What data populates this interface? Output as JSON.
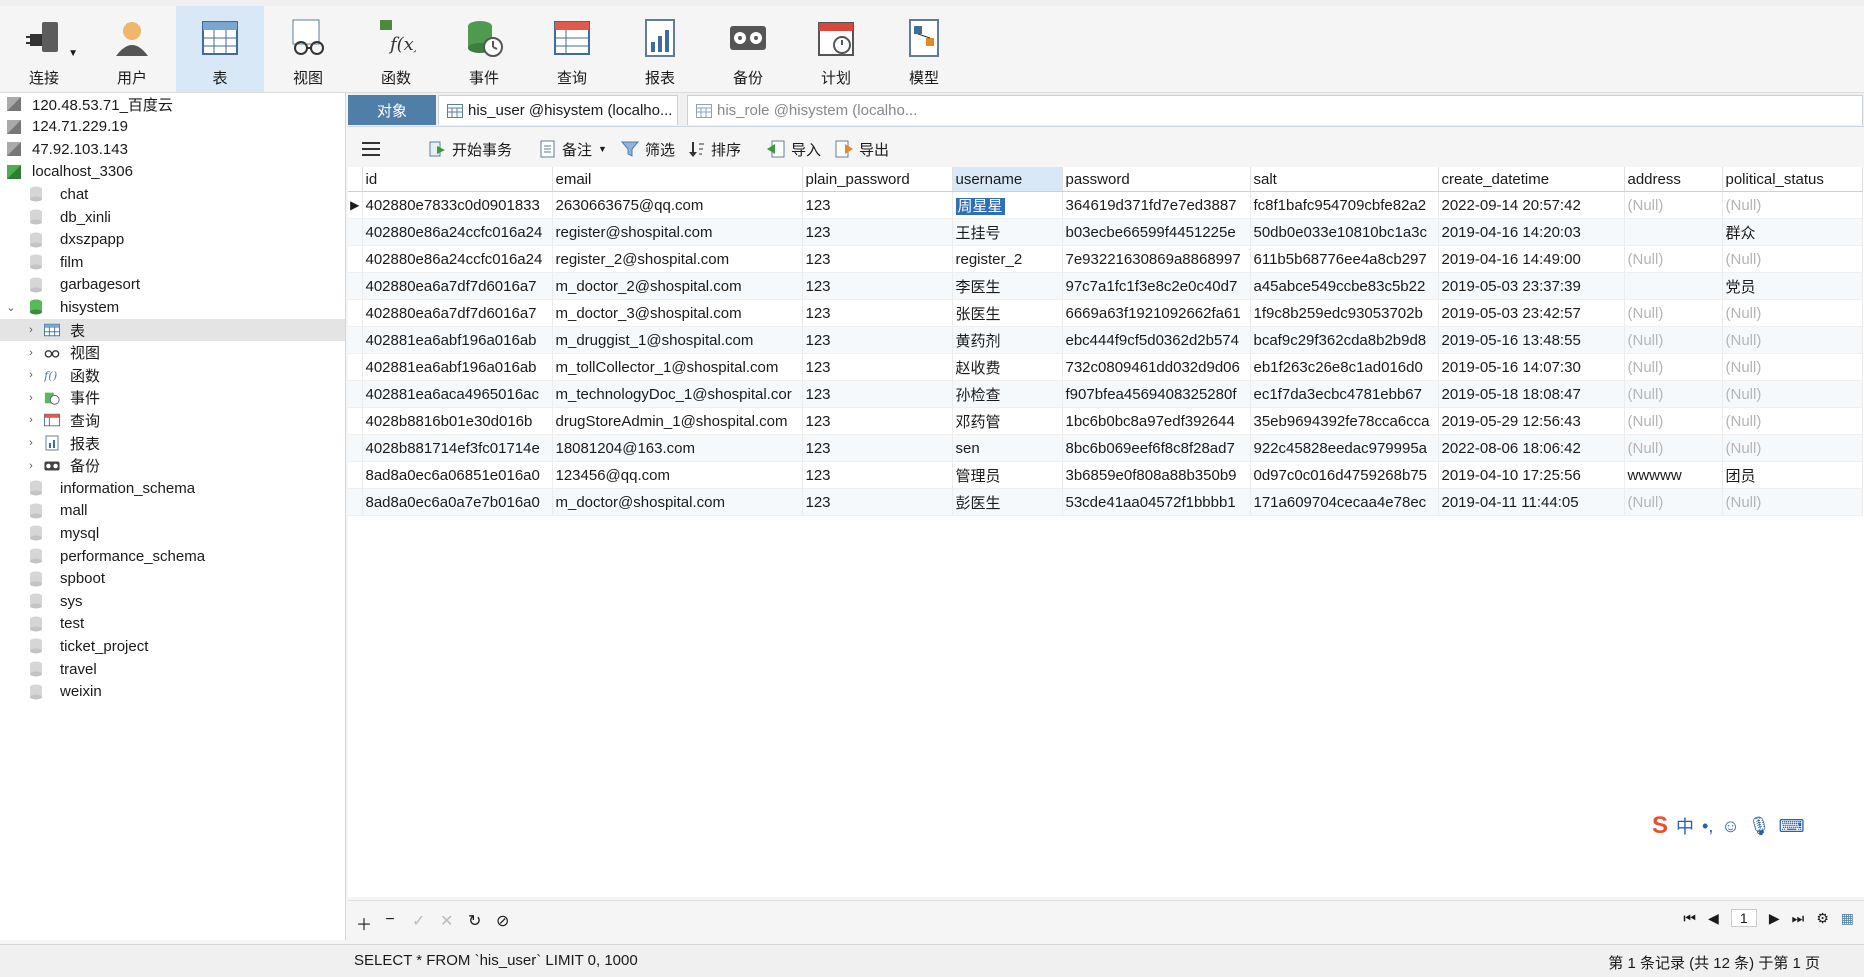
{
  "toolbar": {
    "items": [
      {
        "label": "连接",
        "icon": "plug-icon"
      },
      {
        "label": "用户",
        "icon": "user-icon"
      },
      {
        "label": "表",
        "icon": "table-icon",
        "active": true
      },
      {
        "label": "视图",
        "icon": "view-icon"
      },
      {
        "label": "函数",
        "icon": "function-icon"
      },
      {
        "label": "事件",
        "icon": "event-icon"
      },
      {
        "label": "查询",
        "icon": "query-icon"
      },
      {
        "label": "报表",
        "icon": "report-icon"
      },
      {
        "label": "备份",
        "icon": "backup-icon"
      },
      {
        "label": "计划",
        "icon": "schedule-icon"
      },
      {
        "label": "模型",
        "icon": "model-icon"
      }
    ]
  },
  "sidebar": {
    "items": [
      {
        "label": "120.48.53.71_百度云",
        "type": "connection",
        "depth": 0
      },
      {
        "label": "124.71.229.19",
        "type": "connection",
        "depth": 0
      },
      {
        "label": "47.92.103.143",
        "type": "connection",
        "depth": 0
      },
      {
        "label": "localhost_3306",
        "type": "connection-open",
        "depth": 0
      },
      {
        "label": "chat",
        "type": "database",
        "depth": 1
      },
      {
        "label": "db_xinli",
        "type": "database",
        "depth": 1
      },
      {
        "label": "dxszpapp",
        "type": "database",
        "depth": 1
      },
      {
        "label": "film",
        "type": "database",
        "depth": 1
      },
      {
        "label": "garbagesort",
        "type": "database",
        "depth": 1
      },
      {
        "label": "hisystem",
        "type": "database-open",
        "depth": 1,
        "expanded": true
      },
      {
        "label": "表",
        "type": "tables",
        "depth": 2,
        "selected": true
      },
      {
        "label": "视图",
        "type": "views",
        "depth": 2
      },
      {
        "label": "函数",
        "type": "functions",
        "depth": 2
      },
      {
        "label": "事件",
        "type": "events",
        "depth": 2
      },
      {
        "label": "查询",
        "type": "queries",
        "depth": 2
      },
      {
        "label": "报表",
        "type": "reports",
        "depth": 2
      },
      {
        "label": "备份",
        "type": "backups",
        "depth": 2
      },
      {
        "label": "information_schema",
        "type": "database",
        "depth": 1
      },
      {
        "label": "mall",
        "type": "database",
        "depth": 1
      },
      {
        "label": "mysql",
        "type": "database",
        "depth": 1
      },
      {
        "label": "performance_schema",
        "type": "database",
        "depth": 1
      },
      {
        "label": "spboot",
        "type": "database",
        "depth": 1
      },
      {
        "label": "sys",
        "type": "database",
        "depth": 1
      },
      {
        "label": "test",
        "type": "database",
        "depth": 1
      },
      {
        "label": "ticket_project",
        "type": "database",
        "depth": 1
      },
      {
        "label": "travel",
        "type": "database",
        "depth": 1
      },
      {
        "label": "weixin",
        "type": "database",
        "depth": 1
      }
    ]
  },
  "tabs": {
    "objects": "对象",
    "tab1": "his_user @hisystem (localho...",
    "tab2": "his_role @hisystem (localho..."
  },
  "objbar": {
    "begin_tx": "开始事务",
    "memo": "备注",
    "filter": "筛选",
    "sort": "排序",
    "import": "导入",
    "export": "导出"
  },
  "grid": {
    "columns": [
      "id",
      "email",
      "plain_password",
      "username",
      "password",
      "salt",
      "create_datetime",
      "address",
      "political_status"
    ],
    "rows": [
      [
        "402880e7833c0d0901833",
        "2630663675@qq.com",
        "123",
        "周星星",
        "364619d371fd7e7ed3887",
        "fc8f1bafc954709cbfe82a2",
        "2022-09-14 20:57:42",
        "(Null)",
        "(Null)"
      ],
      [
        "402880e86a24ccfc016a24",
        "register@shospital.com",
        "123",
        "王挂号",
        "b03ecbe66599f4451225e",
        "50db0e033e10810bc1a3c",
        "2019-04-16 14:20:03",
        "",
        "群众"
      ],
      [
        "402880e86a24ccfc016a24",
        "register_2@shospital.com",
        "123",
        "register_2",
        "7e93221630869a8868997",
        "611b5b68776ee4a8cb297",
        "2019-04-16 14:49:00",
        "(Null)",
        "(Null)"
      ],
      [
        "402880ea6a7df7d6016a7",
        "m_doctor_2@shospital.com",
        "123",
        "李医生",
        "97c7a1fc1f3e8c2e0c40d7",
        "a45abce549ccbe83c5b22",
        "2019-05-03 23:37:39",
        "",
        "党员"
      ],
      [
        "402880ea6a7df7d6016a7",
        "m_doctor_3@shospital.com",
        "123",
        "张医生",
        "6669a63f1921092662fa61",
        "1f9c8b259edc93053702b",
        "2019-05-03 23:42:57",
        "(Null)",
        "(Null)"
      ],
      [
        "402881ea6abf196a016ab",
        "m_druggist_1@shospital.com",
        "123",
        "黄药剂",
        "ebc444f9cf5d0362d2b574",
        "bcaf9c29f362cda8b2b9d8",
        "2019-05-16 13:48:55",
        "(Null)",
        "(Null)"
      ],
      [
        "402881ea6abf196a016ab",
        "m_tollCollector_1@shospital.com",
        "123",
        "赵收费",
        "732c0809461dd032d9d06",
        "eb1f263c26e8c1ad016d0",
        "2019-05-16 14:07:30",
        "(Null)",
        "(Null)"
      ],
      [
        "402881ea6aca4965016ac",
        "m_technologyDoc_1@shospital.cor",
        "123",
        "孙检查",
        "f907bfea4569408325280f",
        "ec1f7da3ecbc4781ebb67",
        "2019-05-18 18:08:47",
        "(Null)",
        "(Null)"
      ],
      [
        "4028b8816b01e30d016b",
        "drugStoreAdmin_1@shospital.com",
        "123",
        "邓药管",
        "1bc6b0bc8a97edf392644",
        "35eb9694392fe78cca6cca",
        "2019-05-29 12:56:43",
        "(Null)",
        "(Null)"
      ],
      [
        "4028b881714ef3fc01714e",
        "18081204@163.com",
        "123",
        "sen",
        "8bc6b069eef6f8c8f28ad7",
        "922c45828eedac979995a",
        "2022-08-06 18:06:42",
        "(Null)",
        "(Null)"
      ],
      [
        "8ad8a0ec6a06851e016a0",
        "123456@qq.com",
        "123",
        "管理员",
        "3b6859e0f808a88b350b9",
        "0d97c0c016d4759268b75",
        "2019-04-10 17:25:56",
        "wwwww",
        "团员"
      ],
      [
        "8ad8a0ec6a0a7e7b016a0",
        "m_doctor@shospital.com",
        "123",
        "彭医生",
        "53cde41aa04572f1bbbb1",
        "171a609704cecaa4e78ec",
        "2019-04-11 11:44:05",
        "(Null)",
        "(Null)"
      ]
    ]
  },
  "footer": {
    "page": "1"
  },
  "status": {
    "sql": "SELECT * FROM `his_user` LIMIT 0, 1000",
    "records": "第 1 条记录 (共 12 条) 于第 1 页"
  },
  "ime": {
    "lang": "中"
  },
  "colors": {
    "accent": "#4f7ea8",
    "selection": "#2f6fb8",
    "null_text": "#b5b5b5"
  }
}
